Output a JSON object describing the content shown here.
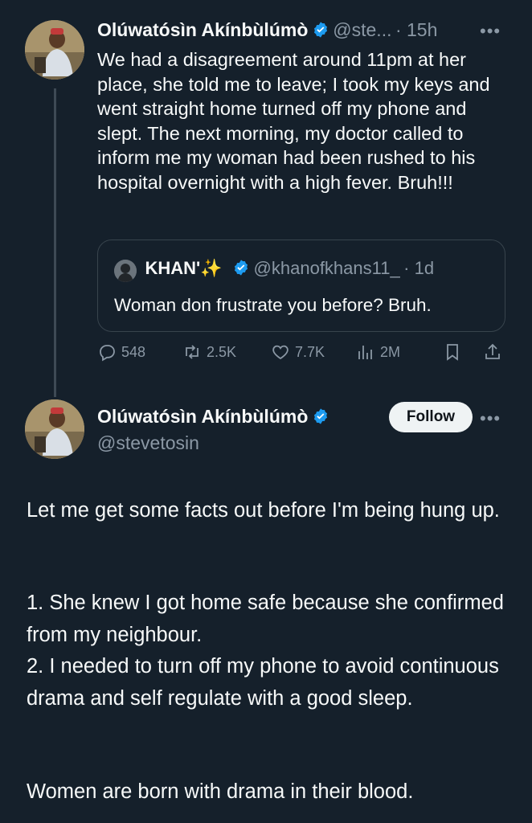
{
  "tweet1": {
    "author_name": "Olúwatósìn Akínbùlúmò",
    "handle": "@ste...",
    "time": "· 15h",
    "more": "•••",
    "text": "We had a disagreement around 11pm at her place, she told me to leave; I took my keys and went straight home turned off my phone and slept. The next morning, my doctor called to inform me my woman had been rushed to his hospital overnight with a high fever. Bruh!!!",
    "quote": {
      "author_name": "KHAN'✨",
      "handle": "@khanofkhans11_",
      "time": "· 1d",
      "text": "Woman don frustrate you before? Bruh."
    },
    "actions": {
      "replies": "548",
      "reposts": "2.5K",
      "likes": "7.7K",
      "views": "2M"
    }
  },
  "tweet2": {
    "author_name": "Olúwatósìn Akínbùlúmò",
    "handle": "@stevetosin",
    "follow_label": "Follow",
    "more": "•••",
    "paragraph1": "Let me get some facts out before I'm being hung up.",
    "point1": "1. She knew I got home safe because she confirmed from my neighbour.",
    "point2": "2. I needed to turn off my phone to avoid continuous drama and self regulate with a good sleep.",
    "closing": "Women are born with drama in their blood."
  },
  "colors": {
    "background": "#15202b",
    "text": "#f7f9f9",
    "muted": "#8b98a5",
    "verified": "#1d9bf0",
    "border": "#38444d"
  },
  "icons": [
    "verified-badge-icon",
    "more-icon",
    "reply-icon",
    "repost-icon",
    "like-icon",
    "views-icon",
    "bookmark-icon",
    "share-icon"
  ]
}
